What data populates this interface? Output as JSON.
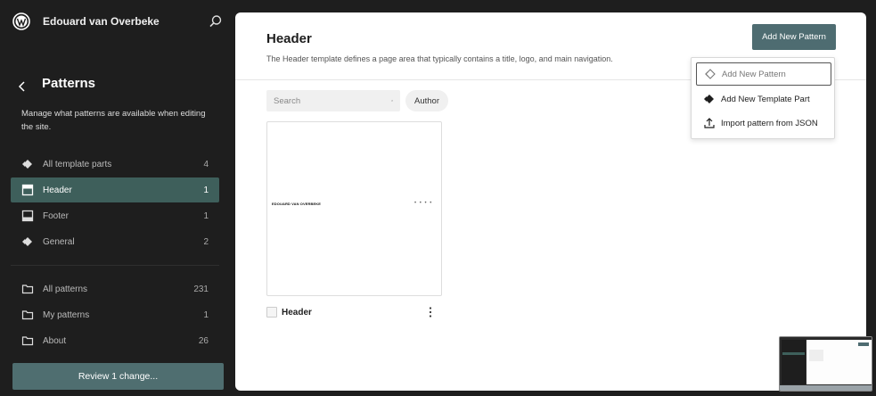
{
  "topbar": {
    "site_name": "Edouard van Overbeke",
    "logo_icon": "wordpress-logo-icon",
    "search_icon": "search-icon"
  },
  "sidebar": {
    "title": "Patterns",
    "description": "Manage what patterns are available when editing the site.",
    "template_parts": [
      {
        "label": "All template parts",
        "count": "4",
        "icon": "symbol-diamond-icon"
      },
      {
        "label": "Header",
        "count": "1",
        "icon": "header-layout-icon",
        "active": true
      },
      {
        "label": "Footer",
        "count": "1",
        "icon": "footer-layout-icon"
      },
      {
        "label": "General",
        "count": "2",
        "icon": "symbol-diamond-icon"
      }
    ],
    "pattern_categories": [
      {
        "label": "All patterns",
        "count": "231",
        "icon": "folder-icon"
      },
      {
        "label": "My patterns",
        "count": "1",
        "icon": "folder-icon"
      },
      {
        "label": "About",
        "count": "26",
        "icon": "folder-icon"
      }
    ],
    "review_button": "Review 1 change..."
  },
  "main": {
    "title": "Header",
    "description": "The Header template defines a page area that typically contains a title, logo, and main navigation.",
    "add_button": "Add New Pattern",
    "search": {
      "placeholder": "Search"
    },
    "author_filter": "Author",
    "cards": [
      {
        "name": "Header",
        "preview_site": "EDOUARD VAN OVERBEKE",
        "preview_menu": "• • • •"
      }
    ]
  },
  "dropdown": {
    "items": [
      {
        "label": "Add New Pattern",
        "icon": "symbol-outline-icon",
        "focused": true
      },
      {
        "label": "Add New Template Part",
        "icon": "symbol-filled-icon"
      },
      {
        "label": "Import pattern from JSON",
        "icon": "upload-icon"
      }
    ]
  },
  "colors": {
    "accent": "#3e5f5b",
    "button": "#4e6c71",
    "sidebar_bg": "#1e1e1e"
  }
}
